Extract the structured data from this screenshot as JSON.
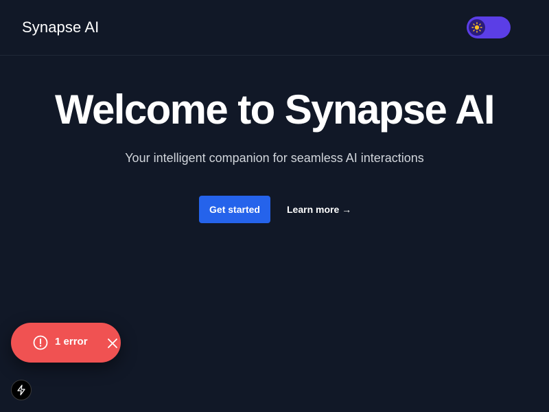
{
  "header": {
    "brand": "Synapse AI",
    "theme_toggle": {
      "state": "dark",
      "icon": "sun-icon"
    }
  },
  "hero": {
    "title": "Welcome to Synapse AI",
    "subtitle": "Your intelligent companion for seamless AI interactions",
    "primary_button": "Get started",
    "secondary_link": "Learn more →"
  },
  "error_toast": {
    "label": "1 error",
    "icon": "alert-circle-icon",
    "close_icon": "close-icon"
  },
  "dev_badge": {
    "icon": "lightning-icon"
  },
  "colors": {
    "background": "#111827",
    "primary": "#2563eb",
    "toggle": "#5b3ee6",
    "error": "#f05252"
  }
}
